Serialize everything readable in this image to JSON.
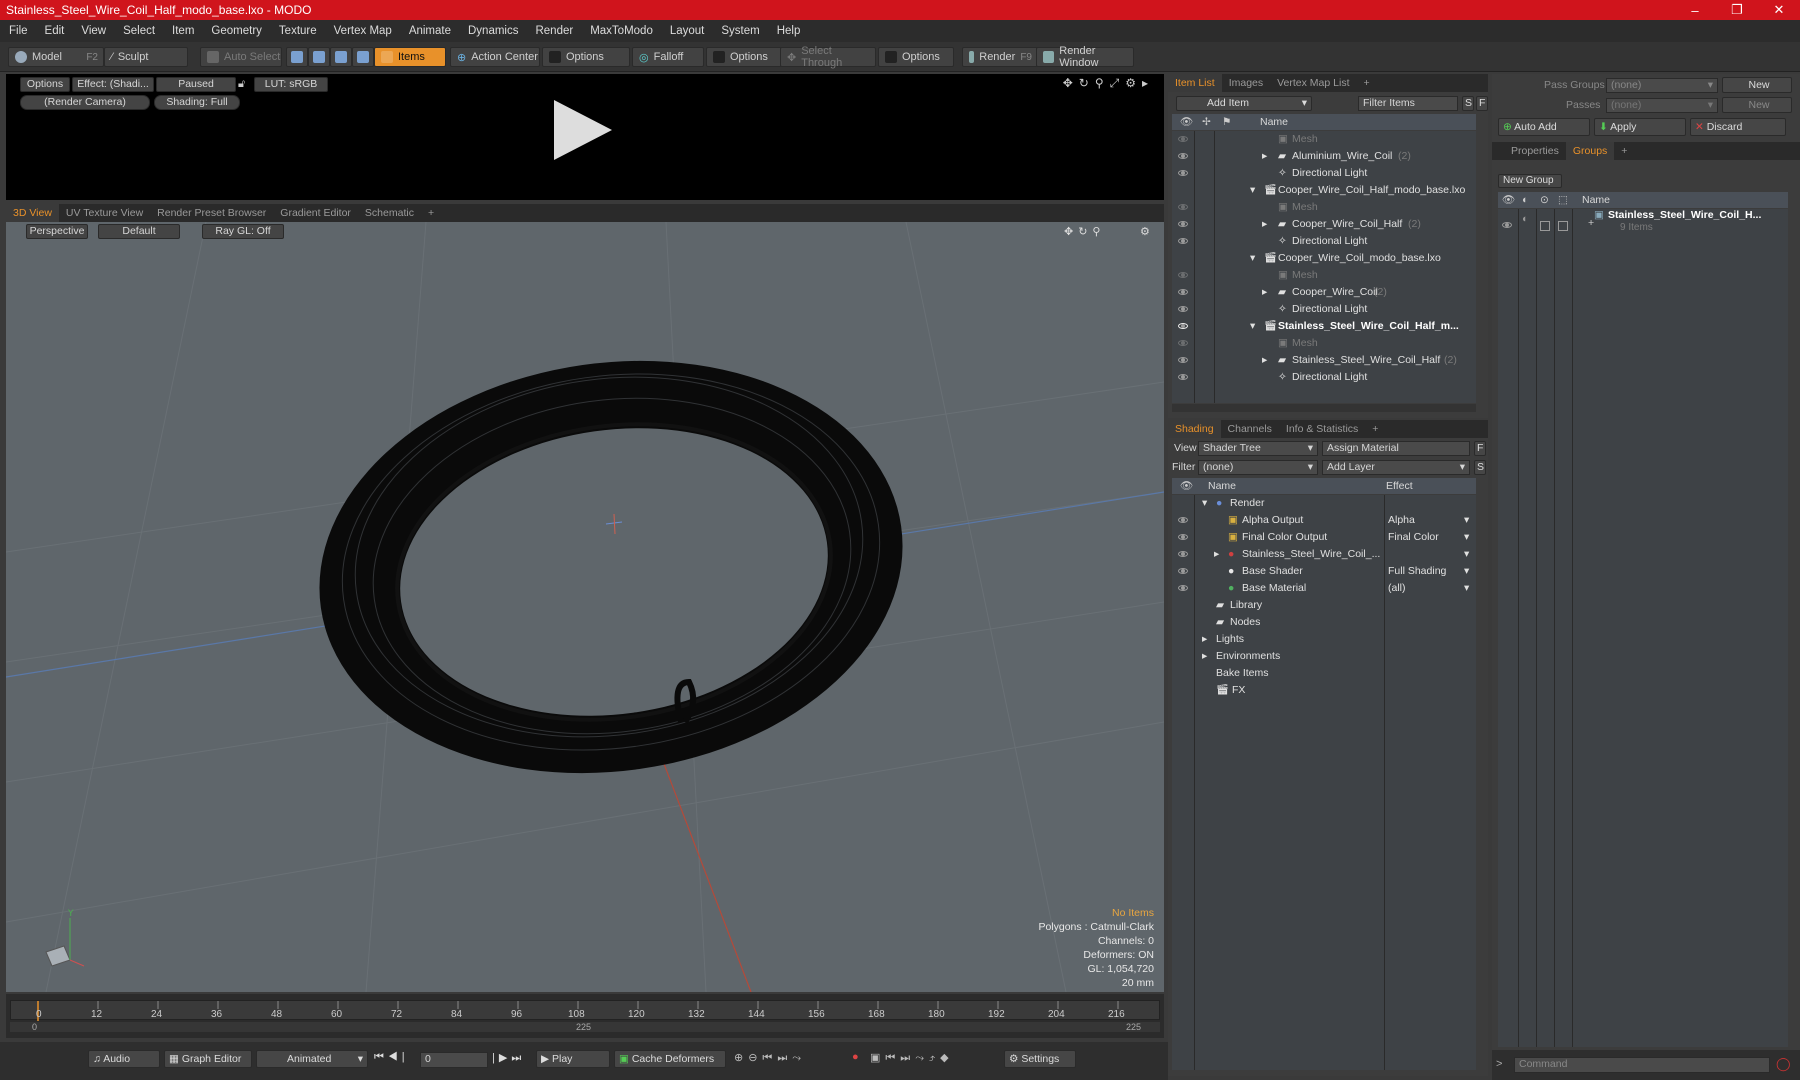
{
  "window": {
    "title": "Stainless_Steel_Wire_Coil_Half_modo_base.lxo - MODO",
    "min": "–",
    "max": "❐",
    "close": "✕"
  },
  "menu": [
    "File",
    "Edit",
    "View",
    "Select",
    "Item",
    "Geometry",
    "Texture",
    "Vertex Map",
    "Animate",
    "Dynamics",
    "Render",
    "MaxToModo",
    "Layout",
    "System",
    "Help"
  ],
  "toolbar": {
    "model": "Model",
    "model_key": "F2",
    "sculpt": "Sculpt",
    "auto_select": "Auto Select",
    "items": "Items",
    "action_center": "Action Center",
    "options1": "Options",
    "falloff": "Falloff",
    "options2": "Options",
    "select_through": "Select Through",
    "options3": "Options",
    "render": "Render",
    "render_key": "F9",
    "render_window": "Render Window"
  },
  "preview": {
    "options": "Options",
    "effect": "Effect: (Shadi...",
    "paused": "Paused",
    "lut": "LUT: sRGB",
    "camera": "(Render Camera)",
    "shading": "Shading: Full"
  },
  "viewport_tabs": [
    "3D View",
    "UV Texture View",
    "Render Preset Browser",
    "Gradient Editor",
    "Schematic",
    "+"
  ],
  "viewport": {
    "perspective": "Perspective",
    "default": "Default",
    "raygl": "Ray GL: Off",
    "info": [
      "No Items",
      "Polygons : Catmull-Clark",
      "Channels: 0",
      "Deformers: ON",
      "GL: 1,054,720",
      "20 mm"
    ]
  },
  "timeline": {
    "ticks": [
      "0",
      "12",
      "24",
      "36",
      "48",
      "60",
      "72",
      "84",
      "96",
      "108",
      "120",
      "132",
      "144",
      "156",
      "168",
      "180",
      "192",
      "204",
      "216"
    ],
    "start": "0",
    "mid": "225",
    "end": "225"
  },
  "bottom": {
    "audio": "Audio",
    "graph_editor": "Graph Editor",
    "animated": "Animated",
    "frame": "0",
    "play": "Play",
    "cache": "Cache Deformers",
    "settings": "Settings"
  },
  "item_list": {
    "tabs": [
      "Item List",
      "Images",
      "Vertex Map List",
      "+"
    ],
    "add_item": "Add Item",
    "filter": "Filter Items",
    "s": "S",
    "f": "F",
    "col_name": "Name",
    "rows": [
      {
        "label": "Mesh",
        "count": ""
      },
      {
        "label": "Aluminium_Wire_Coil",
        "count": "(2)"
      },
      {
        "label": "Directional Light",
        "count": ""
      },
      {
        "label": "Cooper_Wire_Coil_Half_modo_base.lxo",
        "count": ""
      },
      {
        "label": "Mesh",
        "count": ""
      },
      {
        "label": "Cooper_Wire_Coil_Half",
        "count": "(2)"
      },
      {
        "label": "Directional Light",
        "count": ""
      },
      {
        "label": "Cooper_Wire_Coil_modo_base.lxo",
        "count": ""
      },
      {
        "label": "Mesh",
        "count": ""
      },
      {
        "label": "Cooper_Wire_Coil",
        "count": "(2)"
      },
      {
        "label": "Directional Light",
        "count": ""
      },
      {
        "label": "Stainless_Steel_Wire_Coil_Half_m...",
        "count": ""
      },
      {
        "label": "Mesh",
        "count": ""
      },
      {
        "label": "Stainless_Steel_Wire_Coil_Half",
        "count": "(2)"
      },
      {
        "label": "Directional Light",
        "count": ""
      }
    ]
  },
  "shading": {
    "tabs": [
      "Shading",
      "Channels",
      "Info & Statistics",
      "+"
    ],
    "view_label": "View",
    "view_value": "Shader Tree",
    "assign": "Assign Material",
    "f": "F",
    "filter_label": "Filter",
    "filter_value": "(none)",
    "add_layer": "Add Layer",
    "s": "S",
    "col_name": "Name",
    "col_effect": "Effect",
    "rows": [
      {
        "name": "Render",
        "effect": ""
      },
      {
        "name": "Alpha Output",
        "effect": "Alpha"
      },
      {
        "name": "Final Color Output",
        "effect": "Final Color"
      },
      {
        "name": "Stainless_Steel_Wire_Coil_...",
        "effect": ""
      },
      {
        "name": "Base Shader",
        "effect": "Full Shading"
      },
      {
        "name": "Base Material",
        "effect": "(all)"
      },
      {
        "name": "Library",
        "effect": ""
      },
      {
        "name": "Nodes",
        "effect": ""
      },
      {
        "name": "Lights",
        "effect": ""
      },
      {
        "name": "Environments",
        "effect": ""
      },
      {
        "name": "Bake Items",
        "effect": ""
      },
      {
        "name": "FX",
        "effect": ""
      }
    ]
  },
  "right": {
    "pass_groups": "Pass Groups",
    "pass_value": "(none)",
    "new": "New",
    "passes": "Passes",
    "passes_value": "(none)",
    "new2": "New",
    "auto_add": "Auto Add",
    "apply": "Apply",
    "discard": "Discard",
    "tabs": [
      "Properties",
      "Groups",
      "+"
    ],
    "new_group": "New Group",
    "col_name": "Name",
    "group_name": "Stainless_Steel_Wire_Coil_H...",
    "group_count": "9 Items",
    "command": "Command"
  }
}
